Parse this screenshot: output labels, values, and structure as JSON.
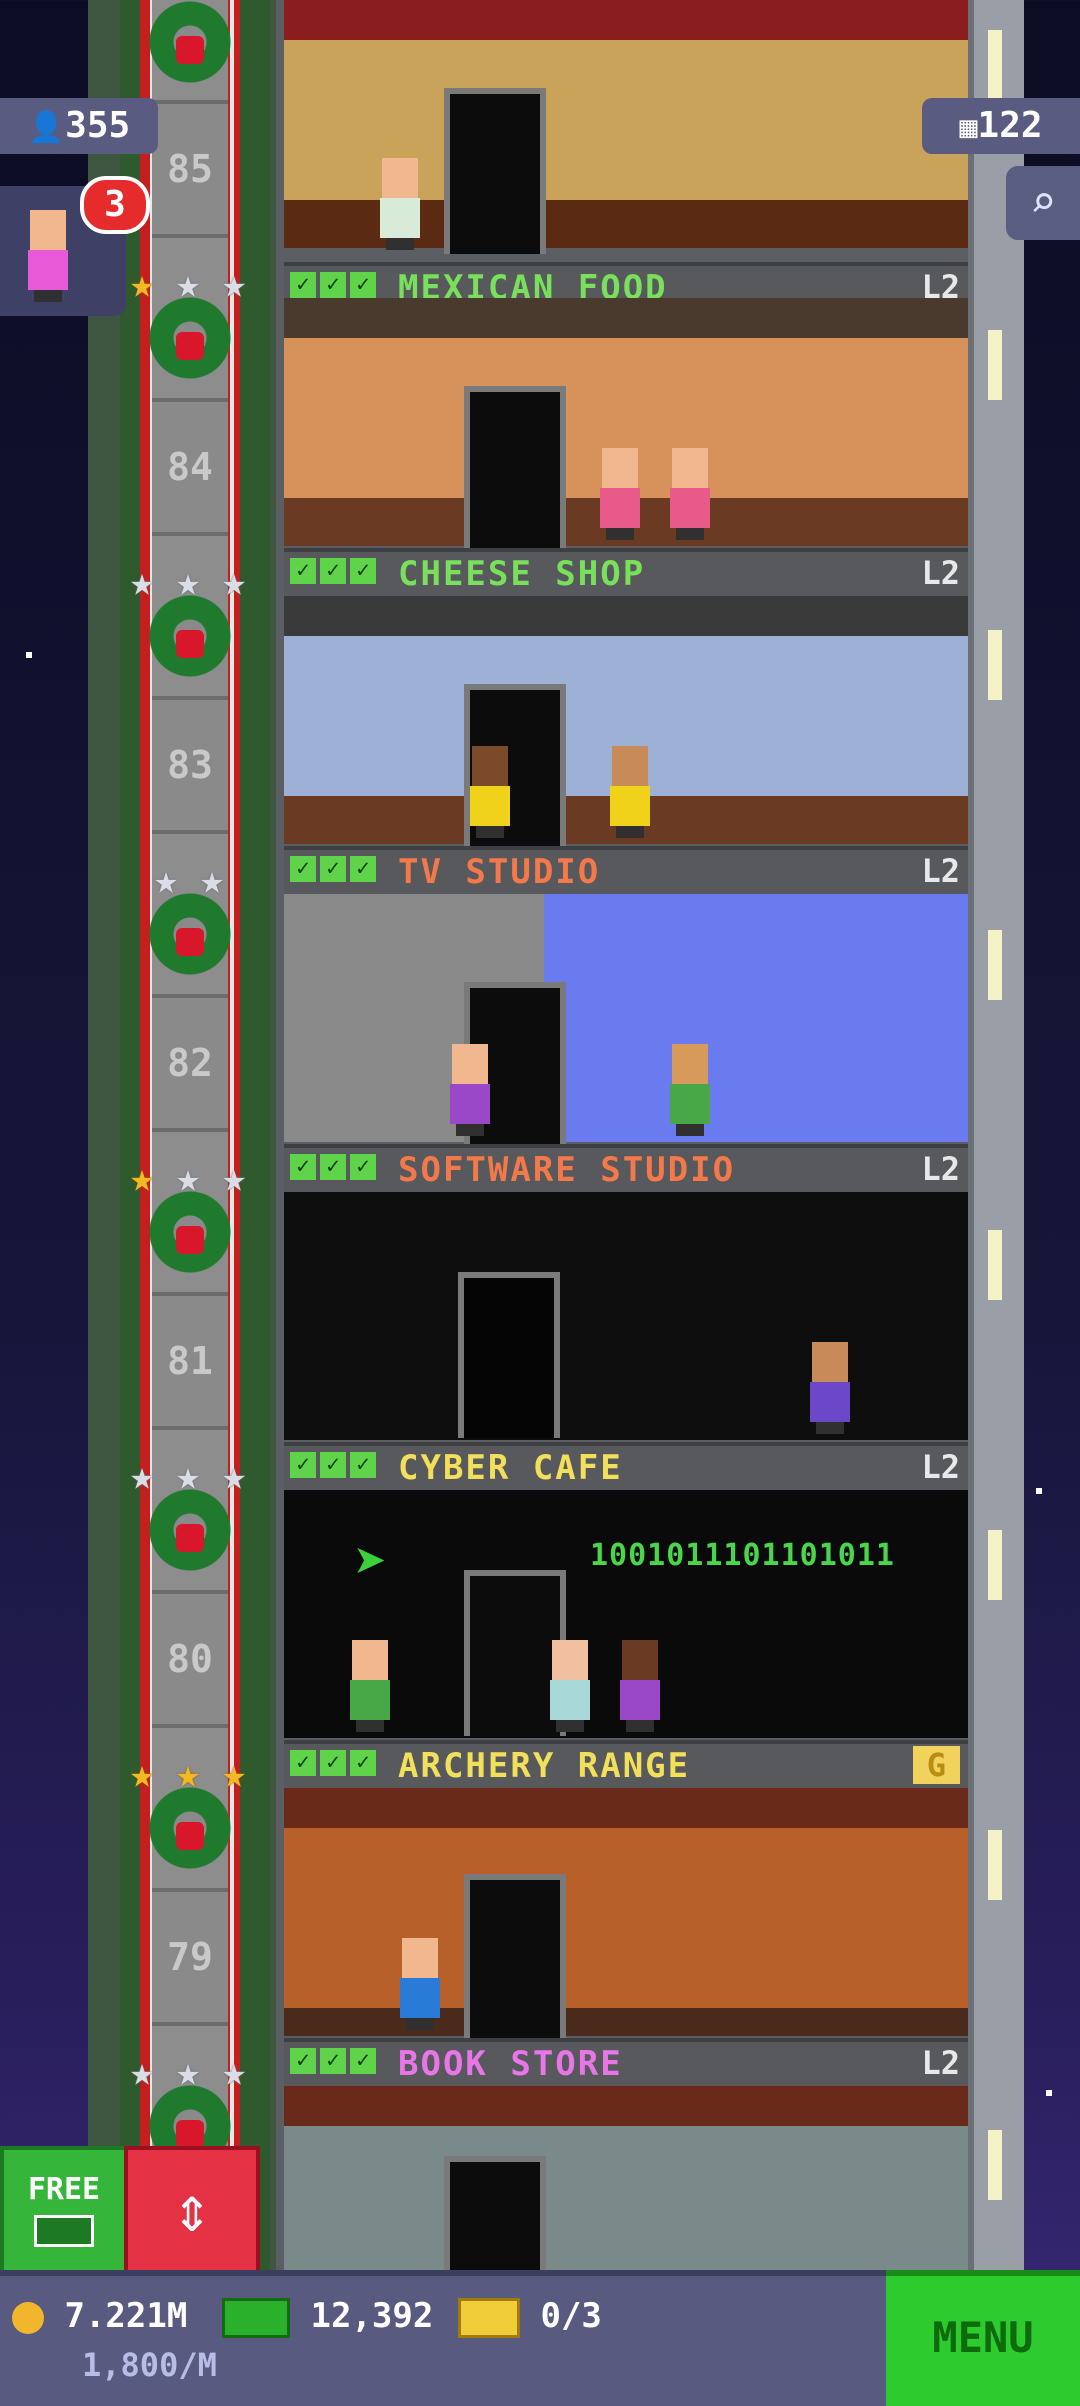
{
  "hud": {
    "population": "355",
    "floor_count": "122",
    "notification_count": "3",
    "coins": "7.221M",
    "income": "1,800/M",
    "bux": "12,392",
    "tickets": "0/3"
  },
  "buttons": {
    "free_label": "FREE",
    "menu_label": "MENU"
  },
  "shaft": {
    "floor_numbers": [
      "85",
      "84",
      "83",
      "82",
      "81",
      "80",
      "79"
    ]
  },
  "floors": [
    {
      "name": "MEXICAN FOOD",
      "level": "L2",
      "name_color": "#78e05a",
      "stars": [
        "gold",
        "silver",
        "silver"
      ]
    },
    {
      "name": "CHEESE SHOP",
      "level": "L2",
      "name_color": "#78e05a",
      "stars": [
        "silver",
        "silver",
        "silver"
      ]
    },
    {
      "name": "TV STUDIO",
      "level": "L2",
      "name_color": "#f4794a",
      "stars": [
        "silver",
        "silver"
      ]
    },
    {
      "name": "SOFTWARE STUDIO",
      "level": "L2",
      "name_color": "#f4794a",
      "stars": [
        "gold",
        "silver",
        "silver"
      ]
    },
    {
      "name": "CYBER CAFE",
      "level": "L2",
      "name_color": "#f2e05a",
      "stars": [
        "silver",
        "silver",
        "silver"
      ]
    },
    {
      "name": "ARCHERY RANGE",
      "level": "G",
      "name_color": "#f2e05a",
      "stars": [
        "gold",
        "gold",
        "gold"
      ]
    },
    {
      "name": "BOOK STORE",
      "level": "L2",
      "name_color": "#e876e8",
      "stars": [
        "silver",
        "silver",
        "silver"
      ]
    }
  ],
  "room_text": {
    "binary_display": "1001011101101011"
  },
  "colors": {
    "hud_bg": "#585a80",
    "menu_green": "#2ecb2e",
    "elevator_red": "#e53144"
  },
  "icons": {
    "population": "person-icon",
    "floors": "building-icon",
    "search": "magnifier-icon",
    "elevator": "up-down-arrows-icon"
  }
}
